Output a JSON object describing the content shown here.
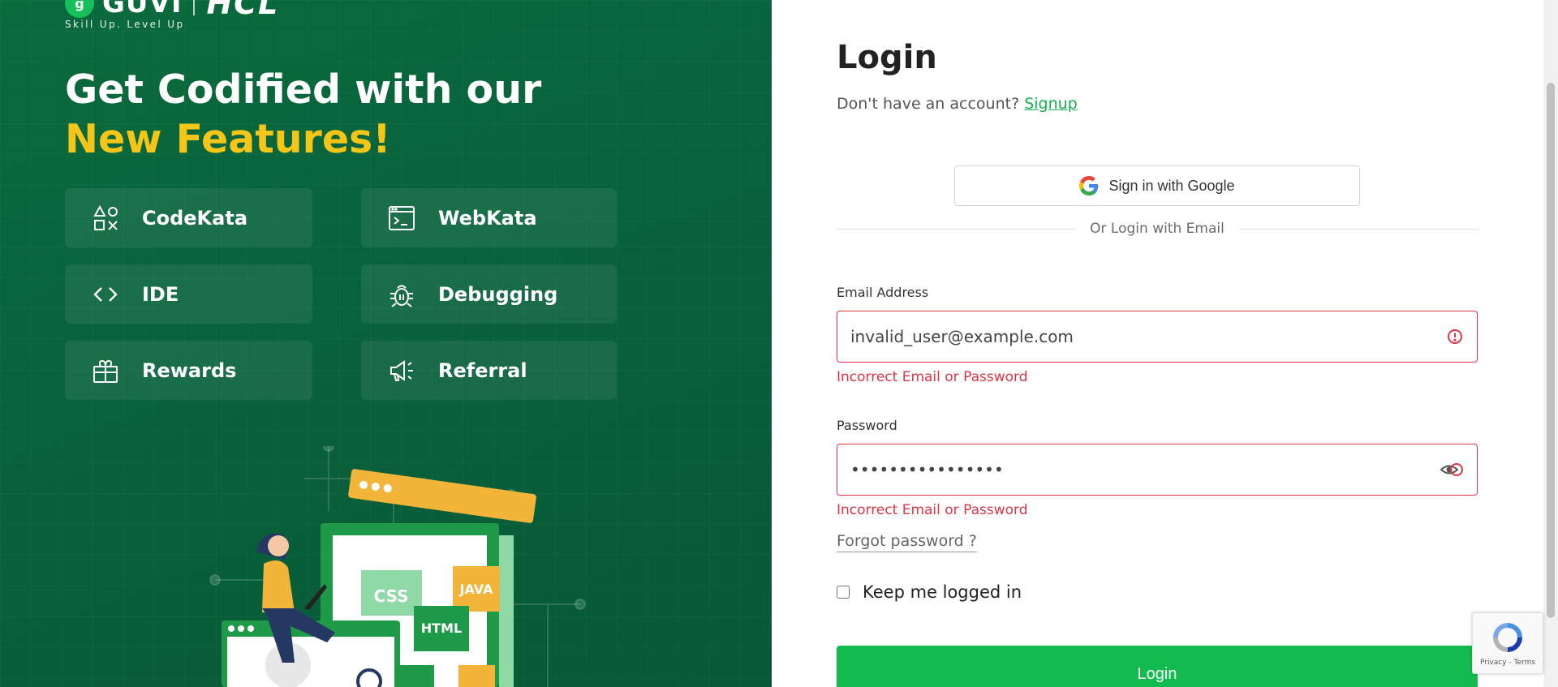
{
  "brand": {
    "name": "GUVI",
    "partner": "HCL",
    "tagline": "Skill Up. Level Up"
  },
  "hero": {
    "headline_part1": "Get Codified with our ",
    "headline_accent": "New Features!"
  },
  "features": [
    {
      "label": "CodeKata",
      "icon": "shapes-icon"
    },
    {
      "label": "WebKata",
      "icon": "terminal-window-icon"
    },
    {
      "label": "IDE",
      "icon": "code-brackets-icon"
    },
    {
      "label": "Debugging",
      "icon": "bug-icon"
    },
    {
      "label": "Rewards",
      "icon": "gift-box-icon"
    },
    {
      "label": "Referral",
      "icon": "megaphone-icon"
    }
  ],
  "illustration": {
    "css_label": "CSS",
    "java_label": "JAVA",
    "html_label": "HTML"
  },
  "login": {
    "title": "Login",
    "no_account_text": "Don't have an account?",
    "signup_link": "Signup",
    "google_button": "Sign in with Google",
    "divider_text": "Or Login with Email",
    "email_label": "Email Address",
    "email_value": "invalid_user@example.com",
    "email_error": "Incorrect Email or Password",
    "password_label": "Password",
    "password_value": "••••••••••••••••",
    "password_error": "Incorrect Email or Password",
    "forgot_link": "Forgot password ?",
    "keep_logged_in": "Keep me logged in",
    "login_button": "Login"
  },
  "recaptcha": {
    "links": "Privacy - Terms"
  },
  "colors": {
    "left_bg": "#08603a",
    "accent_yellow": "#f5c518",
    "primary_green": "#13bb4e",
    "error_red": "#dc3545"
  }
}
